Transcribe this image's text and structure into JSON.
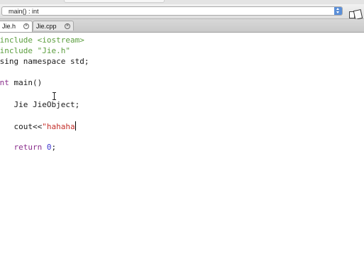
{
  "navigation": {
    "function_selector": "main() : int"
  },
  "tabs": [
    {
      "label": "Jie.h",
      "active": true
    },
    {
      "label": "Jie.cpp",
      "active": false
    }
  ],
  "editor": {
    "lines": [
      [
        {
          "t": "#include <iostream>",
          "c": "pre"
        }
      ],
      [
        {
          "t": "#include \"Jie.h\"",
          "c": "pre"
        }
      ],
      [
        {
          "t": "using namespace std;",
          "c": "plain"
        }
      ],
      [],
      [
        {
          "t": "int",
          "c": "kw"
        },
        {
          "t": " main()",
          "c": "plain"
        }
      ],
      [
        {
          "t": "{",
          "c": "plain"
        }
      ],
      [
        {
          "t": "    Jie JieObject;",
          "c": "plain"
        }
      ],
      [],
      [
        {
          "t": "    ",
          "c": "plain"
        },
        {
          "t": "cout",
          "c": "plain"
        },
        {
          "t": "<<",
          "c": "plain"
        },
        {
          "t": "\"hahaha",
          "c": "str"
        }
      ],
      [],
      [
        {
          "t": "    ",
          "c": "plain"
        },
        {
          "t": "return",
          "c": "kw"
        },
        {
          "t": " ",
          "c": "plain"
        },
        {
          "t": "0",
          "c": "num"
        },
        {
          "t": ";",
          "c": "plain"
        }
      ],
      [
        {
          "t": "}",
          "c": "plain"
        }
      ]
    ],
    "caret_line": 8
  },
  "colors": {
    "preprocessor": "#5c9e3f",
    "keyword": "#8a2f8c",
    "string": "#c4302b",
    "number": "#3c36d0"
  }
}
